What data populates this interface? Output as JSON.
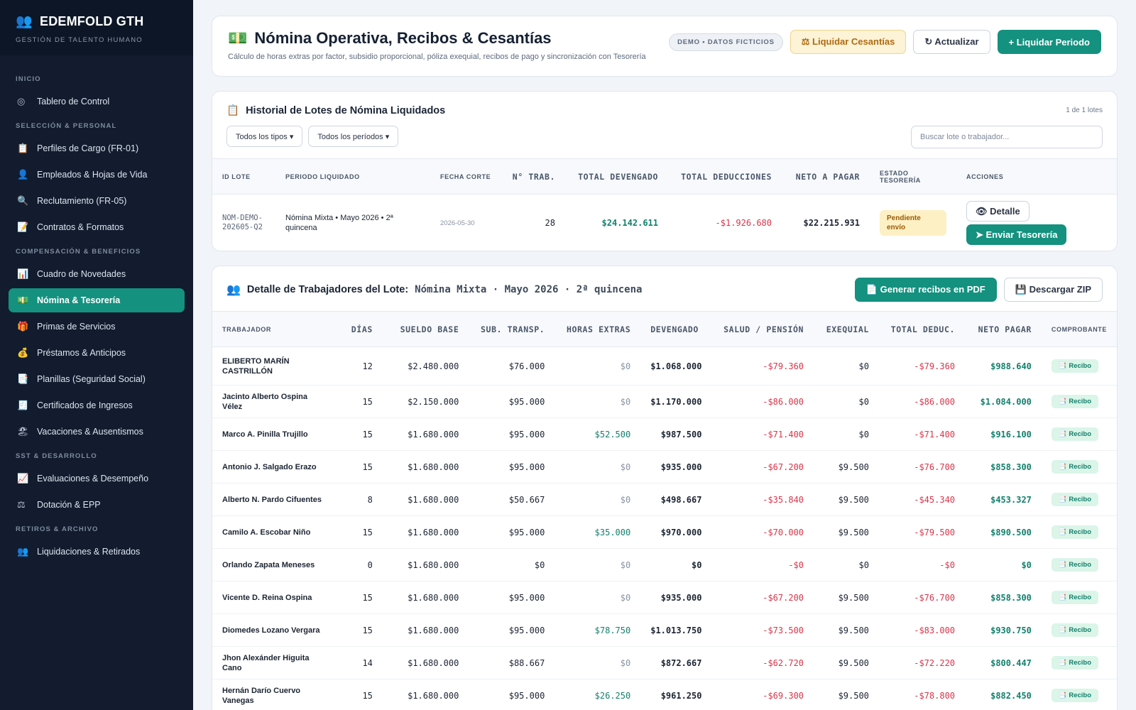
{
  "brand": {
    "name": "EDEMFOLD GTH",
    "subtitle": "GESTIÓN DE TALENTO HUMANO"
  },
  "sidebar": {
    "sections": [
      {
        "title": "INICIO",
        "items": [
          {
            "label": "Tablero de Control",
            "icon": "◎"
          }
        ]
      },
      {
        "title": "SELECCIÓN & PERSONAL",
        "items": [
          {
            "label": "Perfiles de Cargo (FR-01)",
            "icon": "📋"
          },
          {
            "label": "Empleados & Hojas de Vida",
            "icon": "👤"
          },
          {
            "label": "Reclutamiento (FR-05)",
            "icon": "🔍"
          },
          {
            "label": "Contratos & Formatos",
            "icon": "📝"
          }
        ]
      },
      {
        "title": "COMPENSACIÓN & BENEFICIOS",
        "items": [
          {
            "label": "Cuadro de Novedades",
            "icon": "📊"
          },
          {
            "label": "Nómina & Tesorería",
            "icon": "💵",
            "active": true
          },
          {
            "label": "Primas de Servicios",
            "icon": "🎁"
          },
          {
            "label": "Préstamos & Anticipos",
            "icon": "💰"
          },
          {
            "label": "Planillas (Seguridad Social)",
            "icon": "📑"
          },
          {
            "label": "Certificados de Ingresos",
            "icon": "🧾"
          },
          {
            "label": "Vacaciones & Ausentismos",
            "icon": "🏖"
          }
        ]
      },
      {
        "title": "SST & DESARROLLO",
        "items": [
          {
            "label": "Evaluaciones & Desempeño",
            "icon": "📈"
          },
          {
            "label": "Dotación & EPP",
            "icon": "⚖"
          }
        ]
      },
      {
        "title": "RETIROS & ARCHIVO",
        "items": [
          {
            "label": "Liquidaciones & Retirados",
            "icon": "👥"
          }
        ]
      }
    ]
  },
  "header": {
    "icon": "💵",
    "title": "Nómina Operativa, Recibos & Cesantías",
    "subtitle": "Cálculo de horas extras por factor, subsidio proporcional, póliza exequial, recibos de pago y sincronización con Tesorería",
    "badge": "DEMO • DATOS FICTICIOS",
    "btn_cesantias": "⚖ Liquidar Cesantías",
    "btn_actualizar": "↻ Actualizar",
    "btn_liquidar": "+ Liquidar Periodo"
  },
  "lotes": {
    "icon": "📋",
    "title": "Historial de Lotes de Nómina Liquidados",
    "count": "1 de 1 lotes",
    "filter_tipos": "Todos los tipos ▾",
    "filter_periodos": "Todos los períodos ▾",
    "search_placeholder": "Buscar lote o trabajador...",
    "columns": [
      "ID LOTE",
      "PERIODO LIQUIDADO",
      "FECHA CORTE",
      "N° TRAB.",
      "TOTAL DEVENGADO",
      "TOTAL DEDUCCIONES",
      "NETO A PAGAR",
      "ESTADO TESORERÍA",
      "ACCIONES"
    ],
    "row": {
      "id": "NOM-DEMO-202605-Q2",
      "periodo": "Nómina Mixta • Mayo 2026 • 2ª quincena",
      "fecha": "2026-05-30",
      "trabajadores": "28",
      "devengado": "$24.142.611",
      "deducciones": "-$1.926.680",
      "neto": "$22.215.931",
      "estado": "Pendiente envío",
      "btn_detalle": "👁 Detalle",
      "btn_enviar": "➤ Enviar Tesorería"
    }
  },
  "detalle": {
    "icon": "👥",
    "label": "Detalle de Trabajadores del Lote:",
    "period": "Nómina Mixta · Mayo 2026 · 2ª quincena",
    "btn_pdf": "📄 Generar recibos en PDF",
    "btn_zip": "💾 Descargar ZIP",
    "columns": [
      "TRABAJADOR",
      "DÍAS",
      "SUELDO BASE",
      "SUB. TRANSP.",
      "HORAS EXTRAS",
      "DEVENGADO",
      "SALUD / PENSIÓN",
      "EXEQUIAL",
      "TOTAL DEDUC.",
      "NETO PAGAR",
      "COMPROBANTE"
    ],
    "recibo_label": "📑 Recibo",
    "rows": [
      {
        "name": "ELIBERTO MARÍN CASTRILLÓN",
        "dias": "12",
        "sueldo": "$2.480.000",
        "sub": "$76.000",
        "horas": "$0",
        "devengado": "$1.068.000",
        "salud": "-$79.360",
        "exequial": "$0",
        "deduc": "-$79.360",
        "neto": "$988.640"
      },
      {
        "name": "Jacinto Alberto Ospina Vélez",
        "dias": "15",
        "sueldo": "$2.150.000",
        "sub": "$95.000",
        "horas": "$0",
        "devengado": "$1.170.000",
        "salud": "-$86.000",
        "exequial": "$0",
        "deduc": "-$86.000",
        "neto": "$1.084.000"
      },
      {
        "name": "Marco A. Pinilla Trujillo",
        "dias": "15",
        "sueldo": "$1.680.000",
        "sub": "$95.000",
        "horas": "$52.500",
        "devengado": "$987.500",
        "salud": "-$71.400",
        "exequial": "$0",
        "deduc": "-$71.400",
        "neto": "$916.100"
      },
      {
        "name": "Antonio J. Salgado Erazo",
        "dias": "15",
        "sueldo": "$1.680.000",
        "sub": "$95.000",
        "horas": "$0",
        "devengado": "$935.000",
        "salud": "-$67.200",
        "exequial": "$9.500",
        "deduc": "-$76.700",
        "neto": "$858.300"
      },
      {
        "name": "Alberto N. Pardo Cifuentes",
        "dias": "8",
        "sueldo": "$1.680.000",
        "sub": "$50.667",
        "horas": "$0",
        "devengado": "$498.667",
        "salud": "-$35.840",
        "exequial": "$9.500",
        "deduc": "-$45.340",
        "neto": "$453.327"
      },
      {
        "name": "Camilo A. Escobar Niño",
        "dias": "15",
        "sueldo": "$1.680.000",
        "sub": "$95.000",
        "horas": "$35.000",
        "devengado": "$970.000",
        "salud": "-$70.000",
        "exequial": "$9.500",
        "deduc": "-$79.500",
        "neto": "$890.500"
      },
      {
        "name": "Orlando Zapata Meneses",
        "dias": "0",
        "sueldo": "$1.680.000",
        "sub": "$0",
        "horas": "$0",
        "devengado": "$0",
        "salud": "-$0",
        "exequial": "$0",
        "deduc": "-$0",
        "neto": "$0"
      },
      {
        "name": "Vicente D. Reina Ospina",
        "dias": "15",
        "sueldo": "$1.680.000",
        "sub": "$95.000",
        "horas": "$0",
        "devengado": "$935.000",
        "salud": "-$67.200",
        "exequial": "$9.500",
        "deduc": "-$76.700",
        "neto": "$858.300"
      },
      {
        "name": "Diomedes Lozano Vergara",
        "dias": "15",
        "sueldo": "$1.680.000",
        "sub": "$95.000",
        "horas": "$78.750",
        "devengado": "$1.013.750",
        "salud": "-$73.500",
        "exequial": "$9.500",
        "deduc": "-$83.000",
        "neto": "$930.750"
      },
      {
        "name": "Jhon Alexánder Higuita Cano",
        "dias": "14",
        "sueldo": "$1.680.000",
        "sub": "$88.667",
        "horas": "$0",
        "devengado": "$872.667",
        "salud": "-$62.720",
        "exequial": "$9.500",
        "deduc": "-$72.220",
        "neto": "$800.447"
      },
      {
        "name": "Hernán Darío Cuervo Vanegas",
        "dias": "15",
        "sueldo": "$1.680.000",
        "sub": "$95.000",
        "horas": "$26.250",
        "devengado": "$961.250",
        "salud": "-$69.300",
        "exequial": "$9.500",
        "deduc": "-$78.800",
        "neto": "$882.450"
      }
    ]
  }
}
